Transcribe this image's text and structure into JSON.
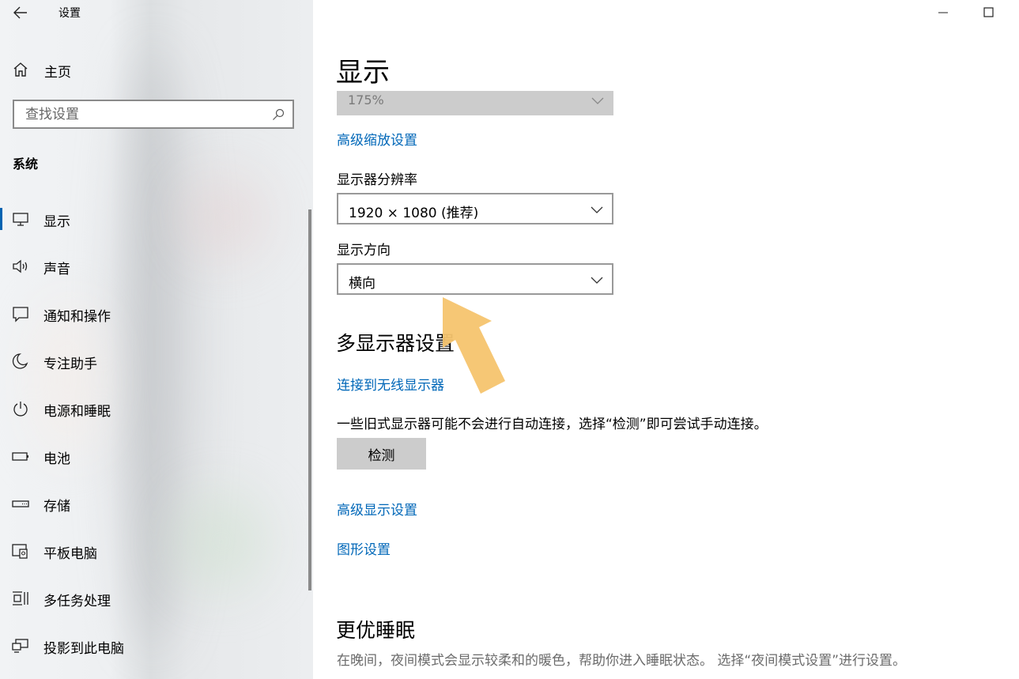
{
  "window": {
    "title": "设置"
  },
  "sidebar": {
    "home_label": "主页",
    "search_placeholder": "查找设置",
    "section_title": "系统",
    "items": [
      {
        "label": "显示",
        "icon": "monitor-icon",
        "selected": true
      },
      {
        "label": "声音",
        "icon": "speaker-icon",
        "selected": false
      },
      {
        "label": "通知和操作",
        "icon": "notification-icon",
        "selected": false
      },
      {
        "label": "专注助手",
        "icon": "moon-icon",
        "selected": false
      },
      {
        "label": "电源和睡眠",
        "icon": "power-icon",
        "selected": false
      },
      {
        "label": "电池",
        "icon": "battery-icon",
        "selected": false
      },
      {
        "label": "存储",
        "icon": "storage-icon",
        "selected": false
      },
      {
        "label": "平板电脑",
        "icon": "tablet-icon",
        "selected": false
      },
      {
        "label": "多任务处理",
        "icon": "multitask-icon",
        "selected": false
      },
      {
        "label": "投影到此电脑",
        "icon": "project-icon",
        "selected": false
      }
    ]
  },
  "main": {
    "page_title": "显示",
    "scale_value": "175%",
    "advanced_scaling_link": "高级缩放设置",
    "resolution_label": "显示器分辨率",
    "resolution_value": "1920 × 1080 (推荐)",
    "orientation_label": "显示方向",
    "orientation_value": "横向",
    "multi_display_title": "多显示器设置",
    "wireless_link": "连接到无线显示器",
    "detect_desc": "一些旧式显示器可能不会进行自动连接，选择“检测”即可尝试手动连接。",
    "detect_button": "检测",
    "advanced_display_link": "高级显示设置",
    "graphics_link": "图形设置",
    "sleep_title": "更优睡眠",
    "sleep_desc": "在晚间，夜间模式会显示较柔和的暖色，帮助你进入睡眠状态。 选择“夜间模式设置”进行设置。"
  },
  "colors": {
    "accent": "#0067b8",
    "selection_bar": "#0063b1",
    "annotation_arrow": "#f6c46e"
  }
}
